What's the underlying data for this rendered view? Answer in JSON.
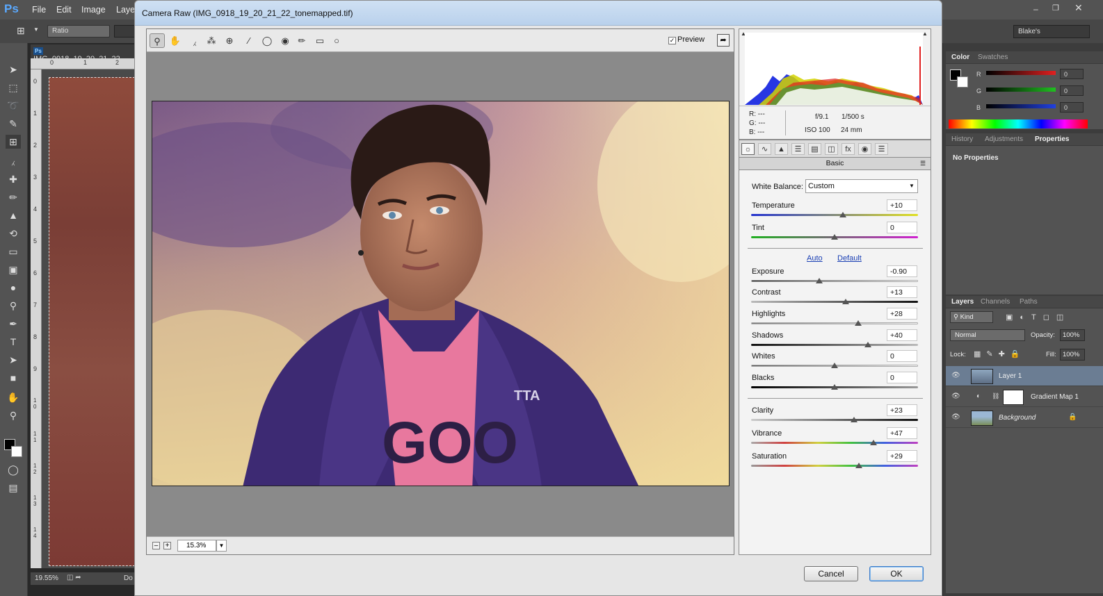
{
  "photoshop": {
    "logo": "Ps",
    "menu": [
      "File",
      "Edit",
      "Image",
      "Laye"
    ],
    "options": {
      "ratio": "Ratio"
    },
    "workspace": "Blake's",
    "document": {
      "tab": "IMG_0918_19_20_21_22_",
      "zoom": "19.55%",
      "status_extra": "Do"
    },
    "ruler_h": [
      "0",
      "1",
      "2"
    ],
    "ruler_v": [
      "0",
      "1",
      "2",
      "3",
      "4",
      "5",
      "6",
      "7",
      "8",
      "9",
      "1 0",
      "1 1",
      "1 2",
      "1 3",
      "1 4"
    ]
  },
  "color_panel": {
    "tabs": [
      "Color",
      "Swatches"
    ],
    "channels": [
      {
        "label": "R",
        "value": "0",
        "color": "#d62020"
      },
      {
        "label": "G",
        "value": "0",
        "color": "#20b020"
      },
      {
        "label": "B",
        "value": "0",
        "color": "#2030d0"
      }
    ]
  },
  "properties_panel": {
    "tabs": [
      "History",
      "Adjustments",
      "Properties"
    ],
    "content": "No Properties"
  },
  "layers_panel": {
    "tabs": [
      "Layers",
      "Channels",
      "Paths"
    ],
    "kind": "Kind",
    "blend_mode": "Normal",
    "opacity_label": "Opacity:",
    "opacity": "100%",
    "lock_label": "Lock:",
    "fill_label": "Fill:",
    "fill": "100%",
    "layers": [
      {
        "name": "Layer 1",
        "selected": true
      },
      {
        "name": "Gradient Map 1",
        "selected": false
      },
      {
        "name": "Background",
        "selected": false
      }
    ]
  },
  "camera_raw": {
    "title": "Camera Raw (IMG_0918_19_20_21_22_tonemapped.tif)",
    "preview_label": "Preview",
    "preview_checked": true,
    "zoom": "15.3%",
    "rgb": {
      "r": "R:  ---",
      "g": "G:  ---",
      "b": "B:  ---"
    },
    "exif": {
      "aperture": "f/9.1",
      "shutter": "1/500 s",
      "iso": "ISO 100",
      "focal": "24 mm"
    },
    "panel_title": "Basic",
    "white_balance_label": "White Balance:",
    "white_balance": "Custom",
    "auto_label": "Auto",
    "default_label": "Default",
    "sliders": {
      "temperature": {
        "label": "Temperature",
        "value": "+10",
        "pos": 0.55
      },
      "tint": {
        "label": "Tint",
        "value": "0",
        "pos": 0.5
      },
      "exposure": {
        "label": "Exposure",
        "value": "-0.90",
        "pos": 0.41
      },
      "contrast": {
        "label": "Contrast",
        "value": "+13",
        "pos": 0.565
      },
      "highlights": {
        "label": "Highlights",
        "value": "+28",
        "pos": 0.64
      },
      "shadows": {
        "label": "Shadows",
        "value": "+40",
        "pos": 0.7
      },
      "whites": {
        "label": "Whites",
        "value": "0",
        "pos": 0.5
      },
      "blacks": {
        "label": "Blacks",
        "value": "0",
        "pos": 0.5
      },
      "clarity": {
        "label": "Clarity",
        "value": "+23",
        "pos": 0.615
      },
      "vibrance": {
        "label": "Vibrance",
        "value": "+47",
        "pos": 0.735
      },
      "saturation": {
        "label": "Saturation",
        "value": "+29",
        "pos": 0.645
      }
    },
    "cancel_label": "Cancel",
    "ok_label": "OK"
  }
}
